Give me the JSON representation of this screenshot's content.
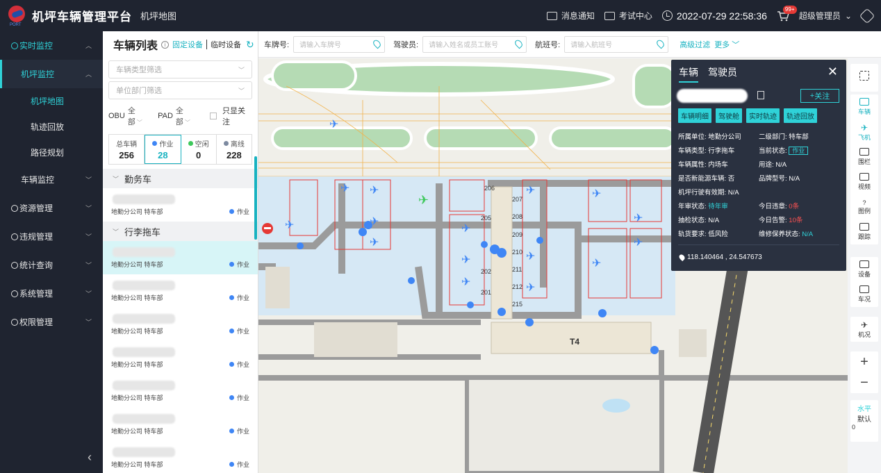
{
  "header": {
    "title": "机坪车辆管理平台",
    "subtitle": "机坪地图",
    "logo_text": "PORT",
    "notify_label": "消息通知",
    "exam_label": "考试中心",
    "datetime": "2022-07-29  22:58:36",
    "cart_badge": "99+",
    "user_label": "超级管理员"
  },
  "sidebar": {
    "items": [
      {
        "label": "实时监控"
      },
      {
        "label": "机坪监控"
      },
      {
        "label": "机坪地图"
      },
      {
        "label": "轨迹回放"
      },
      {
        "label": "路径规划"
      },
      {
        "label": "车辆监控"
      },
      {
        "label": "资源管理"
      },
      {
        "label": "违规管理"
      },
      {
        "label": "统计查询"
      },
      {
        "label": "系统管理"
      },
      {
        "label": "权限管理"
      }
    ]
  },
  "vehicle_list": {
    "title": "车辆列表",
    "tab_fixed": "固定设备",
    "tab_temp": "临时设备",
    "type_placeholder": "车辆类型筛选",
    "dept_placeholder": "单位部门筛选",
    "obu_label": "OBU",
    "obu_value": "全部",
    "pad_label": "PAD",
    "pad_value": "全部",
    "only_follow": "只显关注",
    "stats": [
      {
        "label": "总车辆",
        "value": "256",
        "color": ""
      },
      {
        "label": "作业",
        "value": "28",
        "color": "#3f86f5"
      },
      {
        "label": "空闲",
        "value": "0",
        "color": "#3ec85b"
      },
      {
        "label": "离线",
        "value": "228",
        "color": "#7d8aa0"
      }
    ],
    "groups": [
      {
        "name": "勤务车",
        "rows": [
          {
            "dept": "地勤分公司 特车部",
            "status": "作业"
          }
        ]
      },
      {
        "name": "行李拖车",
        "rows": [
          {
            "dept": "地勤分公司 特车部",
            "status": "作业"
          },
          {
            "dept": "地勤分公司 特车部",
            "status": "作业"
          },
          {
            "dept": "地勤分公司 特车部",
            "status": "作业"
          },
          {
            "dept": "地勤分公司 特车部",
            "status": "作业"
          },
          {
            "dept": "地勤分公司 特车部",
            "status": "作业"
          },
          {
            "dept": "地勤分公司 特车部",
            "status": "作业"
          },
          {
            "dept": "地勤分公司 特车部",
            "status": "作业"
          }
        ]
      }
    ]
  },
  "search": {
    "plate_label": "车牌号:",
    "plate_placeholder": "请输入车牌号",
    "driver_label": "驾驶员:",
    "driver_placeholder": "请输入姓名或员工账号",
    "flight_label": "航班号:",
    "flight_placeholder": "请输入航班号",
    "advanced": "高级过滤",
    "more": "更多"
  },
  "map": {
    "terminal_label": "T4",
    "gates": [
      "206",
      "207",
      "205",
      "208",
      "209",
      "210",
      "202",
      "211",
      "212",
      "201",
      "215"
    ]
  },
  "detail": {
    "tab_vehicle": "车辆",
    "tab_driver": "驾驶员",
    "follow": "关注",
    "buttons": [
      "车辆明细",
      "驾驶舱",
      "实时轨迹",
      "轨迹回放"
    ],
    "fields": [
      [
        "所属单位: 地勤分公司",
        "二级部门: 特车部"
      ],
      [
        "车辆类型: 行李拖车",
        "当前状态:"
      ],
      [
        "车辆属性: 内场车",
        "用途: N/A"
      ],
      [
        "是否新能源车辆: 否",
        "品牌型号: N/A"
      ],
      [
        "机坪行驶有效期: N/A",
        ""
      ],
      [
        "年审状态:",
        "今日违章:"
      ],
      [
        "抽检状态: N/A",
        "今日告警:"
      ],
      [
        "轨货要求: 低风险",
        "维修保养状态:"
      ]
    ],
    "status_tag": "作业",
    "annual_value": "待年审",
    "violations_value": "0条",
    "alarms_value": "10条",
    "maintenance_value": "N/A",
    "coords": "118.140464 , 24.547673"
  },
  "right_toolbar": {
    "items": [
      "车辆",
      "飞机",
      "围栏",
      "视频",
      "图例",
      "跟踪",
      "设备",
      "车况",
      "机况"
    ],
    "view_mode": "水平",
    "view_default": "默认",
    "view_value": "0"
  },
  "colors": {
    "accent": "#2fd2d8",
    "dark": "#1f2430",
    "red": "#e53935",
    "blue": "#3f86f5"
  }
}
